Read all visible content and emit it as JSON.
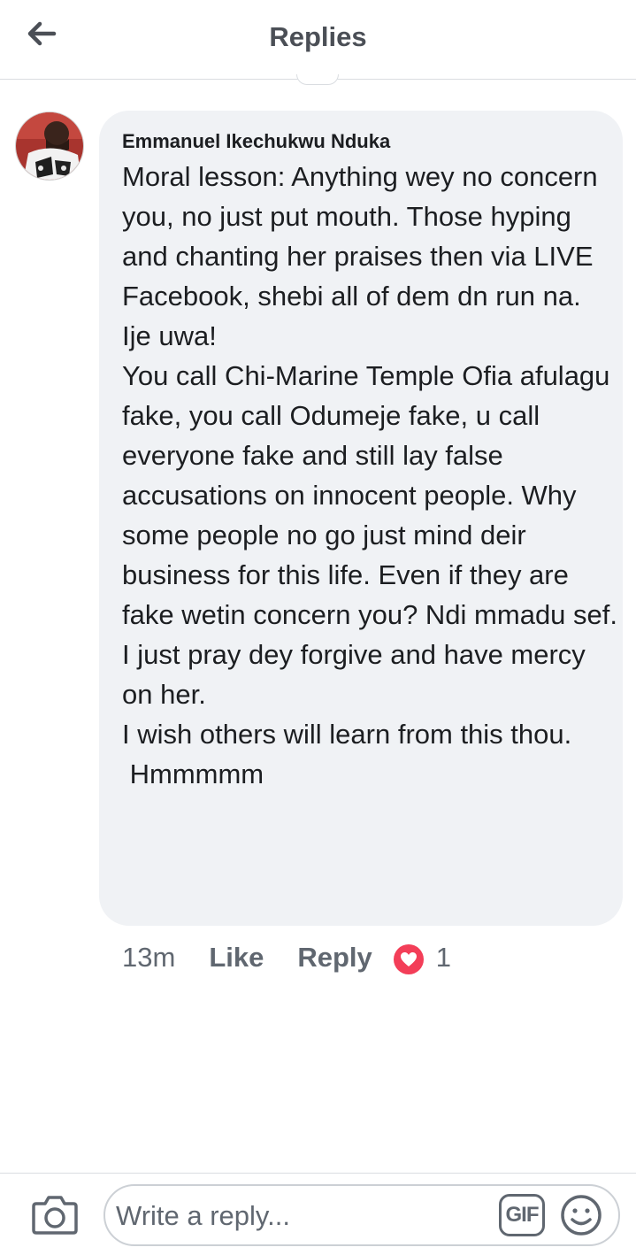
{
  "header": {
    "title": "Replies",
    "back_icon": "arrow-left-icon"
  },
  "comment": {
    "author": "Emmanuel Ikechukwu Nduka",
    "text": "Moral lesson: Anything wey no concern you, no just put mouth. Those hyping and chanting her praises then via LIVE Facebook, shebi all of dem dn run na.\nIje uwa!\nYou call Chi-Marine Temple Ofia afulagu fake, you call Odumeje fake, u call everyone fake and still lay false accusations on innocent people. Why some people no go just mind deir business for this life. Even if they are fake wetin concern you? Ndi mmadu sef.\nI just pray dey forgive and have mercy on her.\nI wish others will learn from this thou.\n Hmmmmm",
    "time": "13m",
    "like_label": "Like",
    "reply_label": "Reply",
    "reaction_icon": "heart-reaction-icon",
    "reaction_count": "1"
  },
  "composer": {
    "placeholder": "Write a reply...",
    "gif_label": "GIF",
    "camera_icon": "camera-icon",
    "emoji_icon": "smiley-icon"
  },
  "colors": {
    "bubble_bg": "#f0f2f5",
    "secondary_text": "#606770",
    "title_text": "#4b4f56",
    "heart": "#f33e58"
  }
}
